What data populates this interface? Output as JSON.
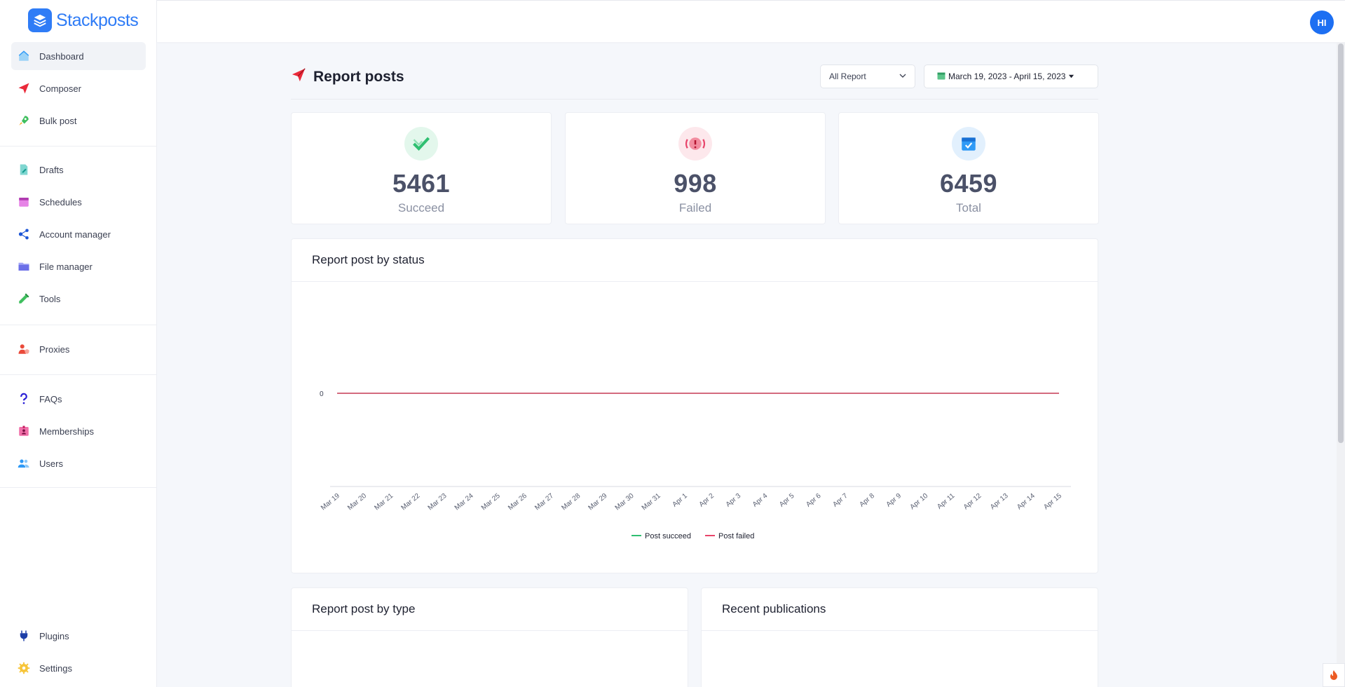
{
  "brand": {
    "name": "Stackposts"
  },
  "sidebar": {
    "group1": [
      {
        "label": "Dashboard",
        "icon": "house-icon",
        "active": true
      },
      {
        "label": "Composer",
        "icon": "paper-plane-icon"
      },
      {
        "label": "Bulk post",
        "icon": "rocket-icon"
      }
    ],
    "group2": [
      {
        "label": "Drafts",
        "icon": "document-pen-icon"
      },
      {
        "label": "Schedules",
        "icon": "calendar-icon"
      },
      {
        "label": "Account manager",
        "icon": "share-nodes-icon"
      },
      {
        "label": "File manager",
        "icon": "folder-icon"
      },
      {
        "label": "Tools",
        "icon": "pencil-ruler-icon"
      }
    ],
    "group3": [
      {
        "label": "Proxies",
        "icon": "user-shield-icon"
      }
    ],
    "group4": [
      {
        "label": "FAQs",
        "icon": "question-mark-icon"
      },
      {
        "label": "Memberships",
        "icon": "id-badge-icon"
      },
      {
        "label": "Users",
        "icon": "users-icon"
      }
    ],
    "bottom": [
      {
        "label": "Plugins",
        "icon": "plug-icon"
      },
      {
        "label": "Settings",
        "icon": "gear-icon"
      }
    ]
  },
  "topbar": {
    "avatar_initials": "HI"
  },
  "header": {
    "title": "Report posts",
    "filter_value": "All Report",
    "date_range": "March 19, 2023 - April 15, 2023"
  },
  "stats": [
    {
      "value": "5461",
      "label": "Succeed",
      "icon": "check-icon",
      "color": "#2fbf71"
    },
    {
      "value": "998",
      "label": "Failed",
      "icon": "alert-icon",
      "color": "#f0506e"
    },
    {
      "value": "6459",
      "label": "Total",
      "icon": "calendar-check-icon",
      "color": "#2f9af6"
    }
  ],
  "panels": {
    "status_title": "Report post by status",
    "type_title": "Report post by type",
    "recent_title": "Recent publications"
  },
  "chart_data": {
    "type": "line",
    "title": "",
    "xlabel": "",
    "ylabel": "",
    "x": [
      "Mar 19",
      "Mar 20",
      "Mar 21",
      "Mar 22",
      "Mar 23",
      "Mar 24",
      "Mar 25",
      "Mar 26",
      "Mar 27",
      "Mar 28",
      "Mar 29",
      "Mar 30",
      "Mar 31",
      "Apr 1",
      "Apr 2",
      "Apr 3",
      "Apr 4",
      "Apr 5",
      "Apr 6",
      "Apr 7",
      "Apr 8",
      "Apr 9",
      "Apr 10",
      "Apr 11",
      "Apr 12",
      "Apr 13",
      "Apr 14",
      "Apr 15"
    ],
    "y_ticks": [
      "0"
    ],
    "ylim": [
      0,
      0
    ],
    "legend_placement": "bottom",
    "grid": false,
    "series": [
      {
        "name": "Post succeed",
        "color": "#2fbf71",
        "values": [
          0,
          0,
          0,
          0,
          0,
          0,
          0,
          0,
          0,
          0,
          0,
          0,
          0,
          0,
          0,
          0,
          0,
          0,
          0,
          0,
          0,
          0,
          0,
          0,
          0,
          0,
          0,
          0
        ]
      },
      {
        "name": "Post failed",
        "color": "#e8456b",
        "values": [
          0,
          0,
          0,
          0,
          0,
          0,
          0,
          0,
          0,
          0,
          0,
          0,
          0,
          0,
          0,
          0,
          0,
          0,
          0,
          0,
          0,
          0,
          0,
          0,
          0,
          0,
          0,
          0
        ]
      }
    ]
  }
}
